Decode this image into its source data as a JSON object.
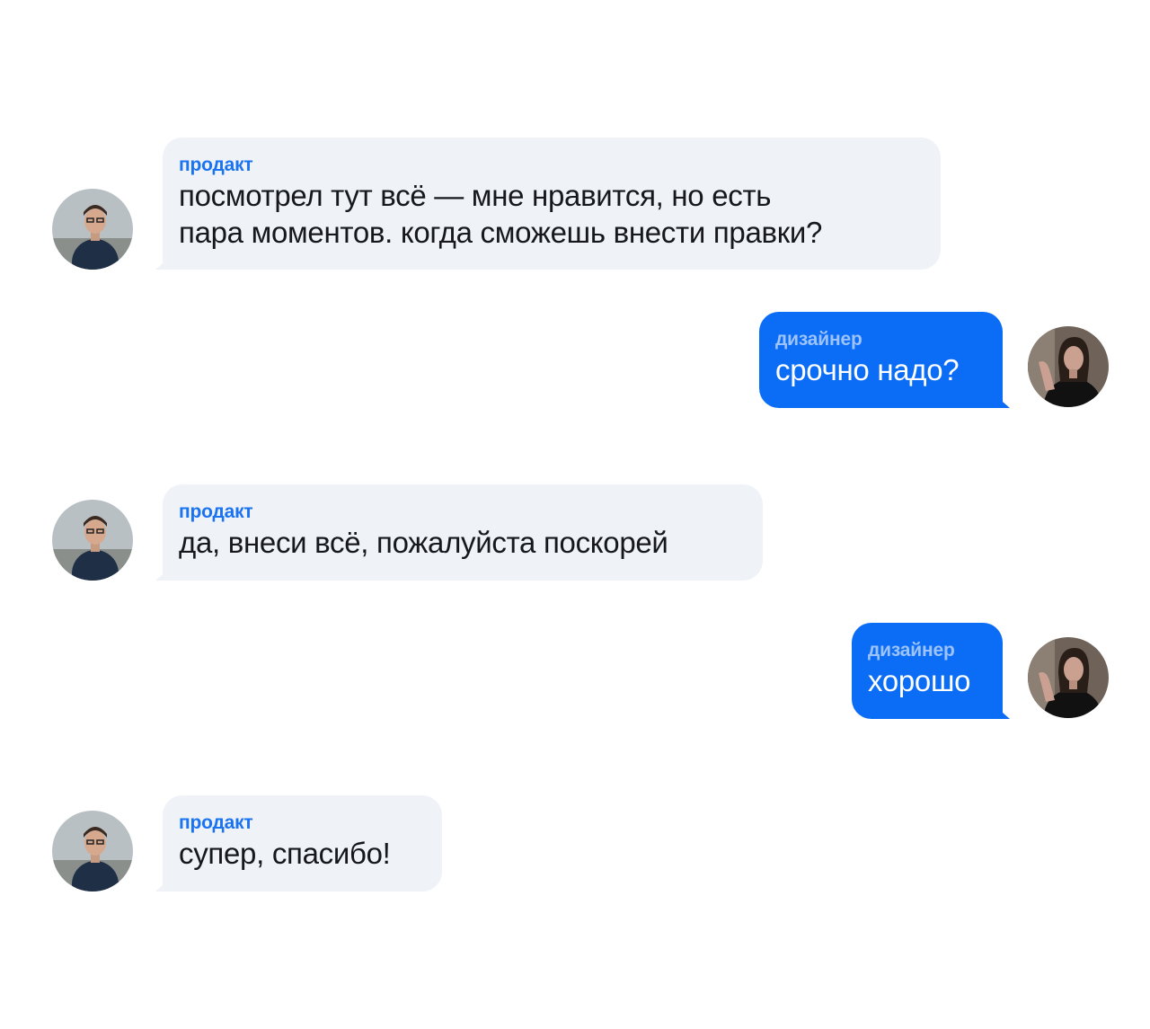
{
  "messages": [
    {
      "sender": "продакт",
      "text": "посмотрел тут всё — мне нравится, но есть\nпара моментов. когда сможешь внести правки?",
      "direction": "incoming",
      "avatar": "man-avatar"
    },
    {
      "sender": "дизайнер",
      "text": "срочно надо?",
      "direction": "outgoing",
      "avatar": "woman-avatar"
    },
    {
      "sender": "продакт",
      "text": "да, внеси всё, пожалуйста поскорей",
      "direction": "incoming",
      "avatar": "man-avatar"
    },
    {
      "sender": "дизайнер",
      "text": "хорошо",
      "direction": "outgoing",
      "avatar": "woman-avatar"
    },
    {
      "sender": "продакт",
      "text": "супер, спасибо!",
      "direction": "incoming",
      "avatar": "man-avatar"
    }
  ],
  "colors": {
    "incoming_bubble": "#eff2f7",
    "outgoing_bubble": "#0b6cf5",
    "incoming_sender": "#1a73f0",
    "outgoing_sender": "#9cc3fb"
  }
}
